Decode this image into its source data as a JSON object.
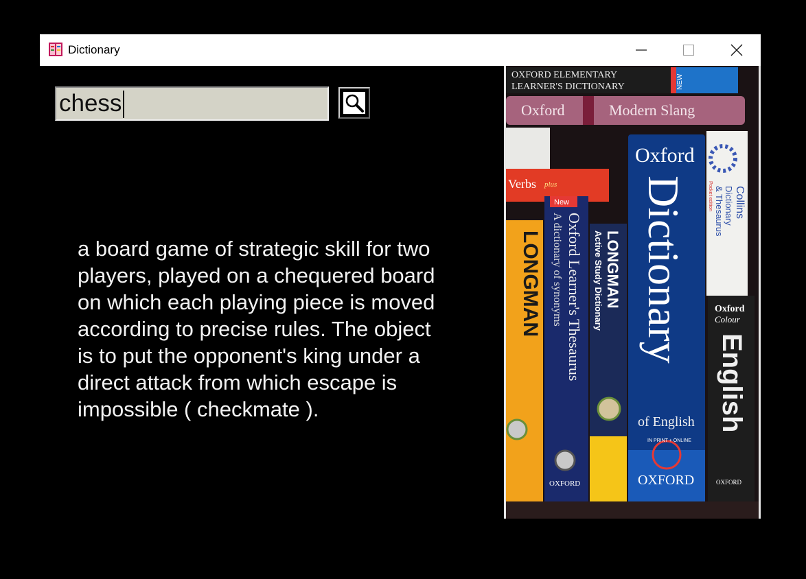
{
  "window": {
    "title": "Dictionary",
    "icon": "dictionary-app-icon"
  },
  "titlebar": {
    "minimize_icon": "minimize-icon",
    "maximize_icon": "maximize-icon",
    "close_icon": "close-icon"
  },
  "search": {
    "value": "chess",
    "button_icon": "search-icon"
  },
  "definition": {
    "text": "a board game of strategic skill for two\nplayers, played on a chequered board\non which each playing piece is moved\naccording to precise rules. The object\nis to put the opponent's king under a\ndirect attack from which escape is\nimpossible ( checkmate )."
  },
  "books_image": {
    "spines": [
      {
        "lines": [
          "OXFORD   ELEMENTARY",
          "LEARNER'S DICTIONARY"
        ],
        "badge": "NEW"
      },
      {
        "lines": [
          "Oxford",
          "Modern Slang"
        ]
      },
      {
        "lines": [
          "Verbs",
          "plus"
        ]
      },
      {
        "lines": [
          "New"
        ]
      },
      {
        "lines": [
          "LONGMAN"
        ]
      },
      {
        "lines": [
          "Oxford Learner's Thesaurus",
          "A dictionary of synonyms"
        ],
        "publisher": "OXFORD"
      },
      {
        "lines": [
          "LONGMAN",
          "Active Study Dictionary"
        ]
      },
      {
        "lines": [
          "Oxford",
          "Dictionary",
          "of English"
        ],
        "publisher": "OXFORD",
        "seal": "IN PRINT + ONLINE"
      },
      {
        "lines": [
          "Collins",
          "Dictionary",
          "& Thesaurus"
        ],
        "badge": "Pocket edition"
      },
      {
        "lines": [
          "Oxford",
          "Colour",
          "English"
        ],
        "publisher": "OXFORD"
      }
    ]
  },
  "colors": {
    "background": "#000000",
    "titlebar": "#ffffff",
    "input_bg": "#d4d3c7",
    "definition_text": "#f2f2f2",
    "oxford_blue": "#0f3a86",
    "longman_orange": "#f2a21b"
  }
}
